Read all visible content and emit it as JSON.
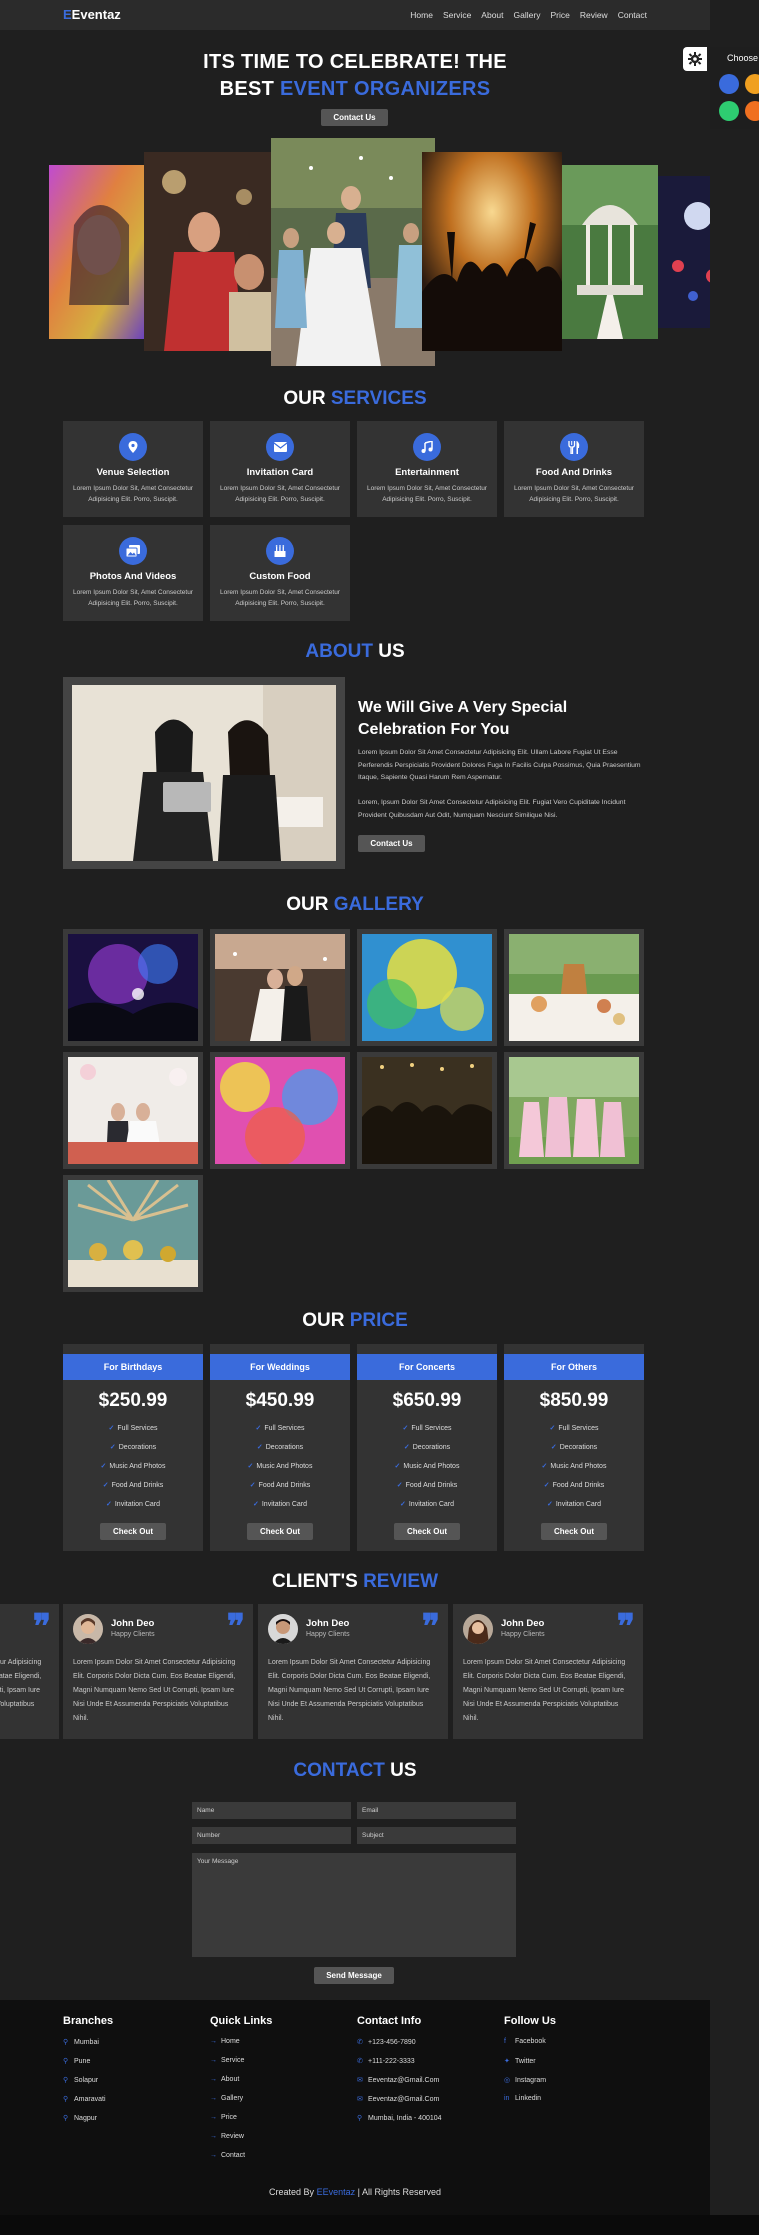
{
  "nav": {
    "brand_letter": "E",
    "brand_rest": "Eventaz",
    "links": [
      "Home",
      "Service",
      "About",
      "Gallery",
      "Price",
      "Review",
      "Contact"
    ]
  },
  "settings": {
    "choose_label": "Choose",
    "swatches": [
      "#3a6bdc",
      "#f0a020",
      "#2ecc71",
      "#f07020"
    ]
  },
  "hero": {
    "title_line1": "ITS TIME TO CELEBRATE! THE",
    "title_line2_plain": "BEST",
    "title_line2_accent": "EVENT ORGANIZERS",
    "button": "Contact Us"
  },
  "services": {
    "title_plain": "OUR",
    "title_accent": "SERVICES",
    "items": [
      {
        "name": "Venue Selection",
        "icon": "map-marker-icon",
        "desc": "Lorem Ipsum Dolor Sit, Amet Consectetur Adipisicing Elit. Porro, Suscipit."
      },
      {
        "name": "Invitation Card",
        "icon": "envelope-icon",
        "desc": "Lorem Ipsum Dolor Sit, Amet Consectetur Adipisicing Elit. Porro, Suscipit."
      },
      {
        "name": "Entertainment",
        "icon": "music-icon",
        "desc": "Lorem Ipsum Dolor Sit, Amet Consectetur Adipisicing Elit. Porro, Suscipit."
      },
      {
        "name": "Food And Drinks",
        "icon": "utensils-icon",
        "desc": "Lorem Ipsum Dolor Sit, Amet Consectetur Adipisicing Elit. Porro, Suscipit."
      },
      {
        "name": "Photos And Videos",
        "icon": "photo-icon",
        "desc": "Lorem Ipsum Dolor Sit, Amet Consectetur Adipisicing Elit. Porro, Suscipit."
      },
      {
        "name": "Custom Food",
        "icon": "birthday-cake-icon",
        "desc": "Lorem Ipsum Dolor Sit, Amet Consectetur Adipisicing Elit. Porro, Suscipit."
      }
    ]
  },
  "about": {
    "title_accent": "ABOUT",
    "title_plain": "US",
    "heading": "We Will Give A Very Special Celebration For You",
    "p1": "Lorem Ipsum Dolor Sit Amet Consectetur Adipisicing Elit. Ullam Labore Fugiat Ut Esse Perferendis Perspiciatis Provident Dolores Fuga In Facilis Culpa Possimus, Quia Praesentium Itaque, Sapiente Quasi Harum Rem Aspernatur.",
    "p2": "Lorem, Ipsum Dolor Sit Amet Consectetur Adipisicing Elit. Fugiat Vero Cupiditate Incidunt Provident Quibusdam Aut Odit, Numquam Nesciunt Similique Nisi.",
    "button": "Contact Us"
  },
  "gallery": {
    "title_plain": "OUR",
    "title_accent": "GALLERY"
  },
  "price": {
    "title_plain": "OUR",
    "title_accent": "PRICE",
    "plans": [
      {
        "name": "For Birthdays",
        "price": "$250.99"
      },
      {
        "name": "For Weddings",
        "price": "$450.99"
      },
      {
        "name": "For Concerts",
        "price": "$650.99"
      },
      {
        "name": "For Others",
        "price": "$850.99"
      }
    ],
    "features": [
      "Full Services",
      "Decorations",
      "Music And Photos",
      "Food And Drinks",
      "Invitation Card"
    ],
    "button": "Check Out"
  },
  "reviews": {
    "title_plain": "CLIENT'S",
    "title_accent": "REVIEW",
    "partial_text": "Lorem Ipsum Dolor Sit Amet Consectetur Adipisicing Elit. Corporis Dolor Dicta Cum. Eos Beatae Eligendi, Magni Numquam Nemo Sed Ut Corrupti, Ipsam Iure Nisi Unde Et Assumenda Perspiciatis Voluptatibus Nihil.",
    "items": [
      {
        "name": "John Deo",
        "role": "Happy Clients",
        "text": "Lorem Ipsum Dolor Sit Amet Consectetur Adipisicing Elit. Corporis Dolor Dicta Cum. Eos Beatae Eligendi, Magni Numquam Nemo Sed Ut Corrupti, Ipsam Iure Nisi Unde Et Assumenda Perspiciatis Voluptatibus Nihil."
      },
      {
        "name": "John Deo",
        "role": "Happy Clients",
        "text": "Lorem Ipsum Dolor Sit Amet Consectetur Adipisicing Elit. Corporis Dolor Dicta Cum. Eos Beatae Eligendi, Magni Numquam Nemo Sed Ut Corrupti, Ipsam Iure Nisi Unde Et Assumenda Perspiciatis Voluptatibus Nihil."
      },
      {
        "name": "John Deo",
        "role": "Happy Clients",
        "text": "Lorem Ipsum Dolor Sit Amet Consectetur Adipisicing Elit. Corporis Dolor Dicta Cum. Eos Beatae Eligendi, Magni Numquam Nemo Sed Ut Corrupti, Ipsam Iure Nisi Unde Et Assumenda Perspiciatis Voluptatibus Nihil."
      }
    ]
  },
  "contact": {
    "title_accent": "CONTACT",
    "title_plain": "US",
    "name_placeholder": "Name",
    "email_placeholder": "Email",
    "number_placeholder": "Number",
    "subject_placeholder": "Subject",
    "message_placeholder": "Your Message",
    "button": "Send Message"
  },
  "footer": {
    "branches_title": "Branches",
    "branches": [
      "Mumbai",
      "Pune",
      "Solapur",
      "Amaravati",
      "Nagpur"
    ],
    "links_title": "Quick Links",
    "links": [
      "Home",
      "Service",
      "About",
      "Gallery",
      "Price",
      "Review",
      "Contact"
    ],
    "contact_title": "Contact Info",
    "contact": [
      {
        "icon": "phone-icon",
        "text": "+123-456-7890"
      },
      {
        "icon": "phone-icon",
        "text": "+111-222-3333"
      },
      {
        "icon": "envelope-icon",
        "text": "Eeventaz@Gmail.Com"
      },
      {
        "icon": "envelope-icon",
        "text": "Eeventaz@Gmail.Com"
      },
      {
        "icon": "map-marker-icon",
        "text": "Mumbai, India - 400104"
      }
    ],
    "follow_title": "Follow Us",
    "social": [
      {
        "icon": "facebook-icon",
        "text": "Facebook"
      },
      {
        "icon": "twitter-icon",
        "text": "Twitter"
      },
      {
        "icon": "instagram-icon",
        "text": "Instagram"
      },
      {
        "icon": "linkedin-icon",
        "text": "Linkedin"
      }
    ],
    "credit_pre": "Created By",
    "credit_brand": "EEventaz",
    "credit_post": "| All Rights Reserved"
  }
}
